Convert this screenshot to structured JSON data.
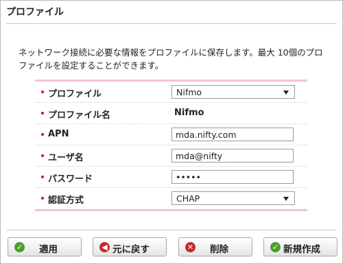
{
  "page": {
    "title": "プロファイル",
    "description": "ネットワーク接続に必要な情報をプロファイルに保存します。最大 10個のプロファイルを設定することができます。"
  },
  "form": {
    "profile": {
      "label": "プロファイル",
      "selected": "Nifmo"
    },
    "profile_name": {
      "label": "プロファイル名",
      "value": "Nifmo"
    },
    "apn": {
      "label": "APN",
      "value": "mda.nifty.com"
    },
    "username": {
      "label": "ユーザ名",
      "value": "mda@nifty"
    },
    "password": {
      "label": "パスワード",
      "value": "•••••"
    },
    "auth": {
      "label": "認証方式",
      "selected": "CHAP"
    }
  },
  "buttons": {
    "apply": {
      "label": "適用",
      "icon": "check-icon",
      "color": "#4c9f2f"
    },
    "revert": {
      "label": "元に戻す",
      "icon": "back-arrow-icon",
      "color": "#c62828"
    },
    "delete": {
      "label": "削除",
      "icon": "close-icon",
      "color": "#c62828"
    },
    "new": {
      "label": "新規作成",
      "icon": "check-icon",
      "color": "#4c9f2f"
    }
  },
  "colors": {
    "accent_pink": "#f1c1d7",
    "bullet_red": "#c8102e"
  }
}
